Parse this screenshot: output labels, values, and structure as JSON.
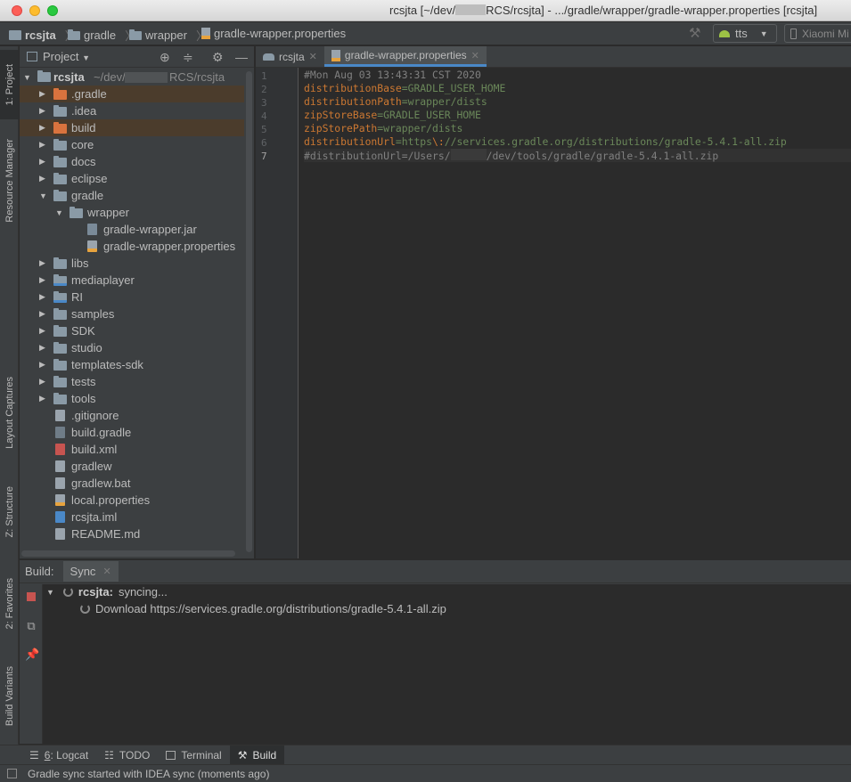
{
  "window": {
    "title_prefix": "rcsjta [~/dev/",
    "title_suffix": "RCS/rcsjta] - .../gradle/wrapper/gradle-wrapper.properties [rcsjta]"
  },
  "breadcrumb": [
    "rcsjta",
    "gradle",
    "wrapper",
    "gradle-wrapper.properties"
  ],
  "toolbar": {
    "run_config": "tts",
    "device": "Xiaomi Mi"
  },
  "left_tabs": {
    "project": "1: Project",
    "resource_manager": "Resource Manager",
    "layout_captures": "Layout Captures",
    "structure": "Z: Structure",
    "favorites": "2: Favorites",
    "build_variants": "Build Variants"
  },
  "project_panel": {
    "title": "Project",
    "root_name": "rcsjta",
    "root_path_prefix": "~/dev/",
    "root_path_suffix": "RCS/rcsjta",
    "items": [
      {
        "label": ".gradle",
        "type": "folder-orange",
        "level": 1,
        "arrow": "closed"
      },
      {
        "label": ".idea",
        "type": "folder",
        "level": 1,
        "arrow": "closed"
      },
      {
        "label": "build",
        "type": "folder-orange",
        "level": 1,
        "arrow": "closed"
      },
      {
        "label": "core",
        "type": "folder",
        "level": 1,
        "arrow": "closed"
      },
      {
        "label": "docs",
        "type": "folder",
        "level": 1,
        "arrow": "closed"
      },
      {
        "label": "eclipse",
        "type": "folder",
        "level": 1,
        "arrow": "closed"
      },
      {
        "label": "gradle",
        "type": "folder",
        "level": 1,
        "arrow": "open"
      },
      {
        "label": "wrapper",
        "type": "folder",
        "level": 2,
        "arrow": "open"
      },
      {
        "label": "gradle-wrapper.jar",
        "type": "file-jar",
        "level": 3,
        "arrow": "none"
      },
      {
        "label": "gradle-wrapper.properties",
        "type": "file-props",
        "level": 3,
        "arrow": "none"
      },
      {
        "label": "libs",
        "type": "folder",
        "level": 1,
        "arrow": "closed"
      },
      {
        "label": "mediaplayer",
        "type": "folder-module",
        "level": 1,
        "arrow": "closed"
      },
      {
        "label": "RI",
        "type": "folder-module",
        "level": 1,
        "arrow": "closed"
      },
      {
        "label": "samples",
        "type": "folder",
        "level": 1,
        "arrow": "closed"
      },
      {
        "label": "SDK",
        "type": "folder",
        "level": 1,
        "arrow": "closed"
      },
      {
        "label": "studio",
        "type": "folder",
        "level": 1,
        "arrow": "closed"
      },
      {
        "label": "templates-sdk",
        "type": "folder",
        "level": 1,
        "arrow": "closed"
      },
      {
        "label": "tests",
        "type": "folder",
        "level": 1,
        "arrow": "closed"
      },
      {
        "label": "tools",
        "type": "folder",
        "level": 1,
        "arrow": "closed"
      },
      {
        "label": ".gitignore",
        "type": "file",
        "level": 1,
        "arrow": "none"
      },
      {
        "label": "build.gradle",
        "type": "file-gradle",
        "level": 1,
        "arrow": "none"
      },
      {
        "label": "build.xml",
        "type": "file-xml",
        "level": 1,
        "arrow": "none"
      },
      {
        "label": "gradlew",
        "type": "file",
        "level": 1,
        "arrow": "none"
      },
      {
        "label": "gradlew.bat",
        "type": "file",
        "level": 1,
        "arrow": "none"
      },
      {
        "label": "local.properties",
        "type": "file-props",
        "level": 1,
        "arrow": "none"
      },
      {
        "label": "rcsjta.iml",
        "type": "file-iml",
        "level": 1,
        "arrow": "none"
      },
      {
        "label": "README.md",
        "type": "file",
        "level": 1,
        "arrow": "none"
      }
    ]
  },
  "editor": {
    "tabs": [
      {
        "label": "rcsjta",
        "active": false
      },
      {
        "label": "gradle-wrapper.properties",
        "active": true
      }
    ],
    "line_numbers": [
      "1",
      "2",
      "3",
      "4",
      "5",
      "6",
      "7"
    ],
    "lines": [
      {
        "comment": "#Mon Aug 03 13:43:31 CST 2020"
      },
      {
        "key": "distributionBase",
        "value": "GRADLE_USER_HOME"
      },
      {
        "key": "distributionPath",
        "value": "wrapper/dists"
      },
      {
        "key": "zipStoreBase",
        "value": "GRADLE_USER_HOME"
      },
      {
        "key": "zipStorePath",
        "value": "wrapper/dists"
      },
      {
        "key": "distributionUrl",
        "value_a": "https",
        "escape": "\\:",
        "value_b": "//services.gradle.org/distributions/gradle-5.4.1-all.zip"
      },
      {
        "comment_a": "#distributionUrl=/Users/",
        "comment_b": "/dev/tools/gradle/gradle-5.4.1-all.zip"
      }
    ]
  },
  "build_panel": {
    "label": "Build:",
    "tab": "Sync",
    "sync_project": "rcsjta:",
    "sync_status": "syncing...",
    "download_text": "Download https://services.gradle.org/distributions/gradle-5.4.1-all.zip"
  },
  "bottom_tabs": [
    {
      "mnemonic": "6",
      "label": ": Logcat",
      "icon": "logcat-icon"
    },
    {
      "mnemonic": "",
      "label": "TODO",
      "icon": "todo-icon"
    },
    {
      "mnemonic": "",
      "label": "Terminal",
      "icon": "terminal-icon"
    },
    {
      "mnemonic": "",
      "label": "Build",
      "icon": "hammer-icon",
      "active": true
    }
  ],
  "status": {
    "message": "Gradle sync started with IDEA sync (moments ago)"
  },
  "colors": {
    "accent": "#4a88c7",
    "key": "#cc7832",
    "value": "#6a8759",
    "comment": "#808080",
    "selection": "#4b3c2c"
  }
}
